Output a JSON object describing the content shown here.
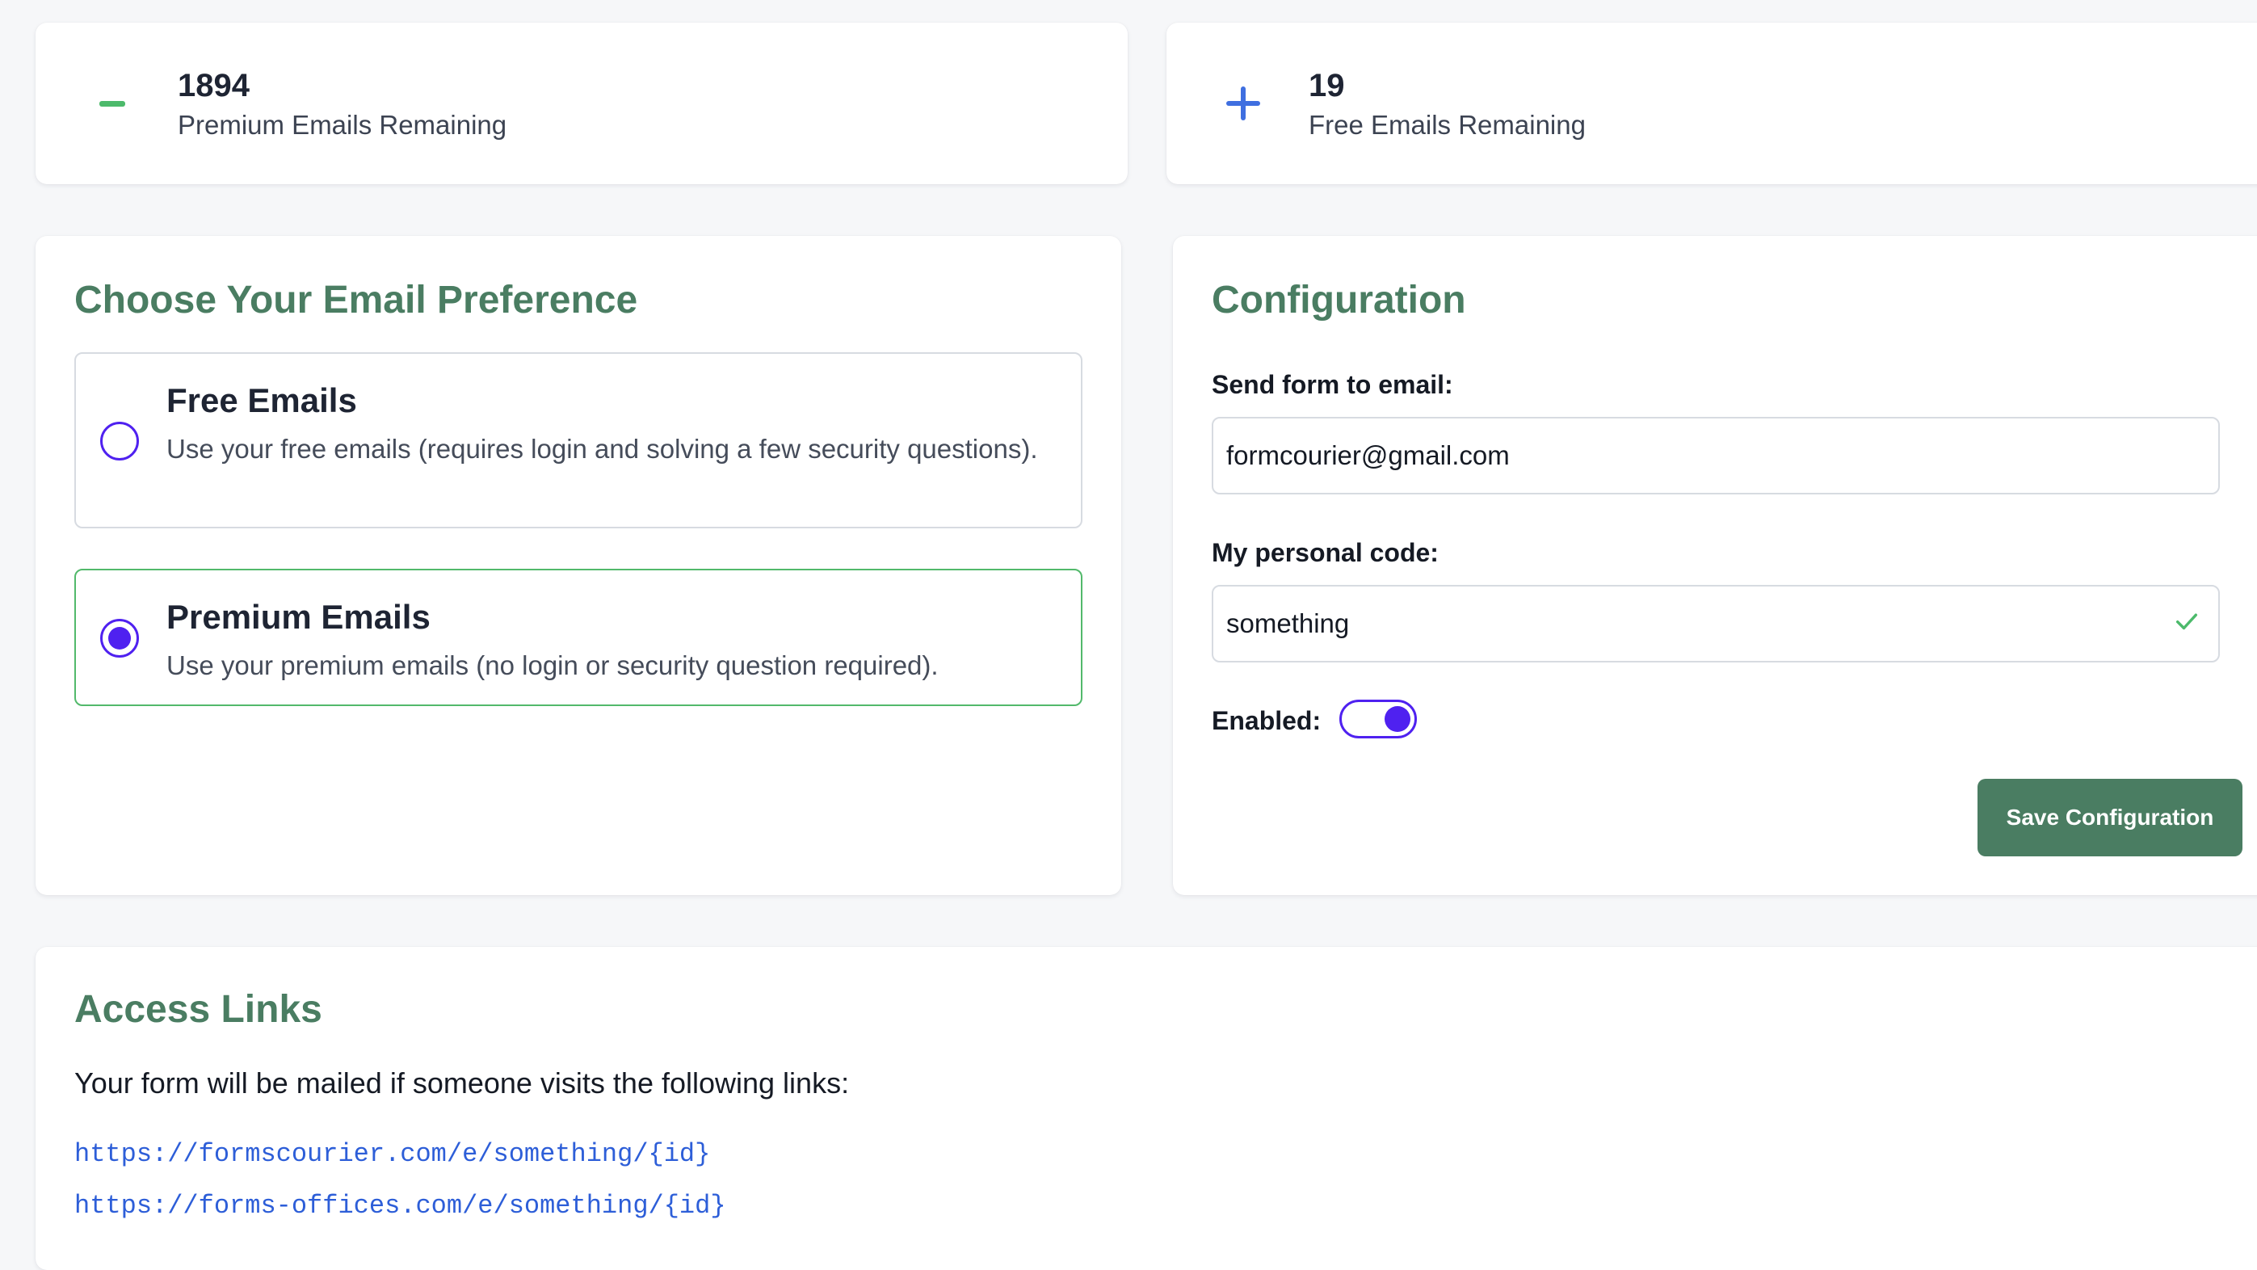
{
  "stats": {
    "premium": {
      "count": "1894",
      "label": "Premium Emails Remaining",
      "icon": "minus-icon",
      "color": "#4cba6b"
    },
    "free": {
      "count": "19",
      "label": "Free Emails Remaining",
      "icon": "plus-icon",
      "color": "#3f6fe0"
    }
  },
  "preference": {
    "title": "Choose Your Email Preference",
    "options": [
      {
        "title": "Free Emails",
        "description": "Use your free emails (requires login and solving a few security questions).",
        "selected": false
      },
      {
        "title": "Premium Emails",
        "description": "Use your premium emails (no login or security question required).",
        "selected": true
      }
    ]
  },
  "config": {
    "title": "Configuration",
    "email_label": "Send form to email:",
    "email_value": "formcourier@gmail.com",
    "code_label": "My personal code:",
    "code_value": "something",
    "enabled_label": "Enabled:",
    "enabled": true,
    "save_label": "Save Configuration"
  },
  "access": {
    "title": "Access Links",
    "intro": "Your form will be mailed if someone visits the following links:",
    "links": [
      "https://formscourier.com/e/something/{id}",
      "https://forms-offices.com/e/something/{id}"
    ]
  },
  "colors": {
    "accent_green": "#4a7d62",
    "radio_purple": "#4f21f0",
    "selected_border": "#52b96b",
    "link_blue": "#2d5ed8"
  }
}
